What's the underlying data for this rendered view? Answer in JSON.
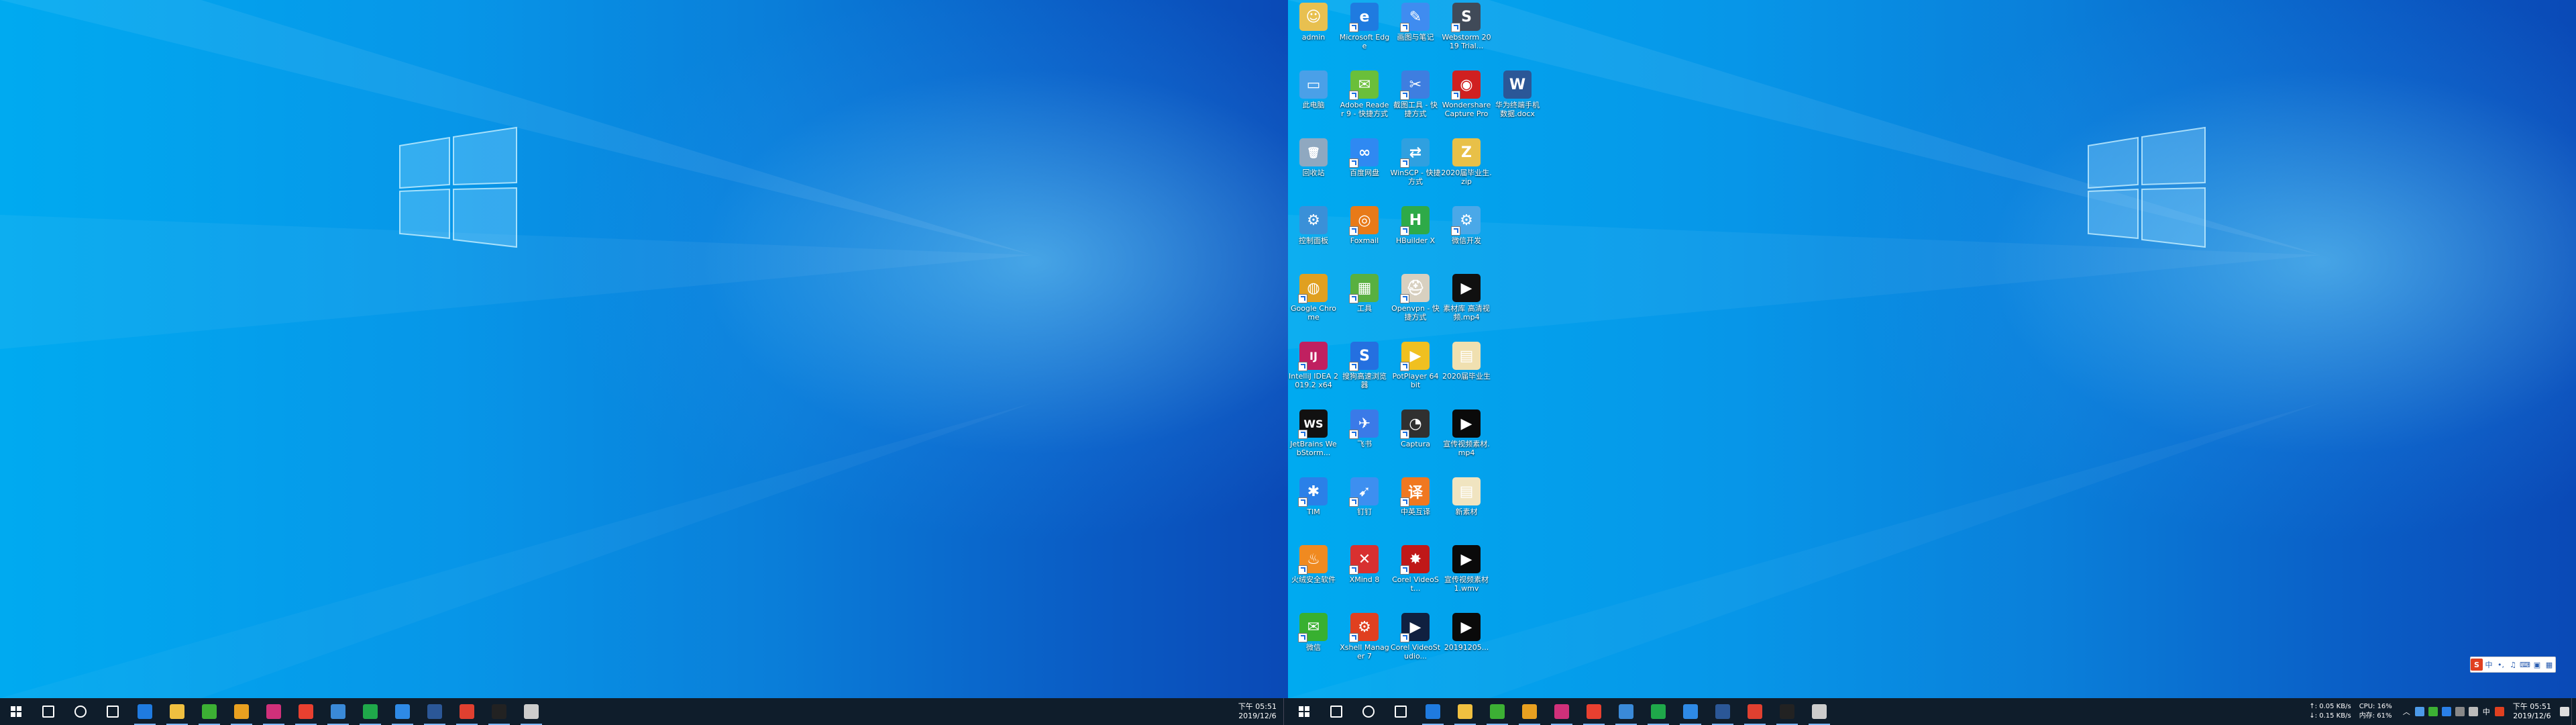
{
  "left_monitor": {
    "taskbar": {
      "apps": [
        {
          "name": "search-icon",
          "color": "#ffffff"
        },
        {
          "name": "cortana-icon",
          "color": "#ffffff"
        },
        {
          "name": "task-view-icon",
          "color": "#ffffff"
        },
        {
          "name": "edge-icon",
          "color": "#1f7be0"
        },
        {
          "name": "file-explorer-icon",
          "color": "#f0c040"
        },
        {
          "name": "wechat-icon",
          "color": "#3cb034"
        },
        {
          "name": "chrome-icon",
          "color": "#e8a020"
        },
        {
          "name": "idea-icon",
          "color": "#d0307a"
        },
        {
          "name": "maps-icon",
          "color": "#e84030"
        },
        {
          "name": "chart-app-icon",
          "color": "#3a8ad8"
        },
        {
          "name": "heidisql-icon",
          "color": "#1fa84a"
        },
        {
          "name": "notes-icon",
          "color": "#2e8ae6"
        },
        {
          "name": "word-icon",
          "color": "#2b5797"
        },
        {
          "name": "red-app-icon",
          "color": "#e04030"
        },
        {
          "name": "terminal-icon",
          "color": "#222222"
        },
        {
          "name": "typora-icon",
          "color": "#cccccc"
        }
      ],
      "clock": {
        "time": "下午 05:51",
        "date": "2019/12/6"
      }
    }
  },
  "right_monitor": {
    "desktop_icons": [
      {
        "label": "admin",
        "color": "#e8c050",
        "glyph": "☺",
        "col": 0,
        "row": 0,
        "shortcut": false
      },
      {
        "label": "Microsoft Edge",
        "color": "#1f7be0",
        "glyph": "e",
        "col": 1,
        "row": 0,
        "shortcut": true
      },
      {
        "label": "画图与笔记",
        "color": "#3f8cf0",
        "glyph": "✎",
        "col": 2,
        "row": 0,
        "shortcut": true
      },
      {
        "label": "Webstorm 2019 Trial...",
        "color": "#404a58",
        "glyph": "S",
        "col": 3,
        "row": 0,
        "shortcut": true
      },
      {
        "label": "此电脑",
        "color": "#4aa0e8",
        "glyph": "▭",
        "col": 0,
        "row": 1,
        "shortcut": false
      },
      {
        "label": "Adobe Reader 9 - 快捷方式",
        "color": "#6abf3a",
        "glyph": "✉",
        "col": 1,
        "row": 1,
        "shortcut": true
      },
      {
        "label": "截图工具 - 快捷方式",
        "color": "#3e7ee0",
        "glyph": "✂",
        "col": 2,
        "row": 1,
        "shortcut": true
      },
      {
        "label": "Wondershare Capture Pro",
        "color": "#d02020",
        "glyph": "◉",
        "col": 3,
        "row": 1,
        "shortcut": true
      },
      {
        "label": "华为终端手机数据.docx",
        "color": "#2b5797",
        "glyph": "W",
        "col": 4,
        "row": 1,
        "shortcut": false
      },
      {
        "label": "回收站",
        "color": "#8fa8c0",
        "glyph": "🗑",
        "col": 0,
        "row": 2,
        "shortcut": false
      },
      {
        "label": "百度网盘",
        "color": "#2f89f2",
        "glyph": "∞",
        "col": 1,
        "row": 2,
        "shortcut": true
      },
      {
        "label": "WinSCP - 快捷方式",
        "color": "#2fa0e0",
        "glyph": "⇄",
        "col": 2,
        "row": 2,
        "shortcut": true
      },
      {
        "label": "2020届毕业生.zip",
        "color": "#e8c048",
        "glyph": "Z",
        "col": 3,
        "row": 2,
        "shortcut": false
      },
      {
        "label": "控制面板",
        "color": "#3a90d8",
        "glyph": "⚙",
        "col": 0,
        "row": 3,
        "shortcut": false
      },
      {
        "label": "Foxmail",
        "color": "#e87a18",
        "glyph": "◎",
        "col": 1,
        "row": 3,
        "shortcut": true
      },
      {
        "label": "HBuilder X",
        "color": "#2eaa48",
        "glyph": "H",
        "col": 2,
        "row": 3,
        "shortcut": true
      },
      {
        "label": "微信开发",
        "color": "#4aa8e8",
        "glyph": "⚙",
        "col": 3,
        "row": 3,
        "shortcut": true
      },
      {
        "label": "Google Chrome",
        "color": "#e0a020",
        "glyph": "◍",
        "col": 0,
        "row": 4,
        "shortcut": true
      },
      {
        "label": "工具",
        "color": "#58b040",
        "glyph": "▦",
        "col": 1,
        "row": 4,
        "shortcut": true
      },
      {
        "label": "Openvpn - 快捷方式",
        "color": "#d8d0c0",
        "glyph": "⛑",
        "col": 2,
        "row": 4,
        "shortcut": true
      },
      {
        "label": "素材库 高清视频.mp4",
        "color": "#101010",
        "glyph": "▶",
        "col": 3,
        "row": 4,
        "shortcut": false
      },
      {
        "label": "IntelliJ IDEA 2019.2 x64",
        "color": "#c02060",
        "glyph": "IJ",
        "col": 0,
        "row": 5,
        "shortcut": true
      },
      {
        "label": "搜狗高速浏览器",
        "color": "#2470e0",
        "glyph": "S",
        "col": 1,
        "row": 5,
        "shortcut": true
      },
      {
        "label": "PotPlayer 64 bit",
        "color": "#f0c020",
        "glyph": "▶",
        "col": 2,
        "row": 5,
        "shortcut": true
      },
      {
        "label": "2020届毕业生",
        "color": "#f0e0b0",
        "glyph": "▤",
        "col": 3,
        "row": 5,
        "shortcut": false
      },
      {
        "label": "JetBrains WebStorm...",
        "color": "#111111",
        "glyph": "WS",
        "col": 0,
        "row": 6,
        "shortcut": true
      },
      {
        "label": "飞书",
        "color": "#3a7ae8",
        "glyph": "✈",
        "col": 1,
        "row": 6,
        "shortcut": true
      },
      {
        "label": "Captura",
        "color": "#303030",
        "glyph": "◔",
        "col": 2,
        "row": 6,
        "shortcut": true
      },
      {
        "label": "宣传视频素材.mp4",
        "color": "#0a0a0a",
        "glyph": "▶",
        "col": 3,
        "row": 6,
        "shortcut": false
      },
      {
        "label": "TIM",
        "color": "#2a80e8",
        "glyph": "✱",
        "col": 0,
        "row": 7,
        "shortcut": true
      },
      {
        "label": "钉钉",
        "color": "#3d8ff0",
        "glyph": "➹",
        "col": 1,
        "row": 7,
        "shortcut": true
      },
      {
        "label": "中英互译",
        "color": "#f07820",
        "glyph": "译",
        "col": 2,
        "row": 7,
        "shortcut": true
      },
      {
        "label": "新素材",
        "color": "#f0e4c0",
        "glyph": "▤",
        "col": 3,
        "row": 7,
        "shortcut": false
      },
      {
        "label": "火绒安全软件",
        "color": "#f08a20",
        "glyph": "♨",
        "col": 0,
        "row": 8,
        "shortcut": true
      },
      {
        "label": "XMind 8",
        "color": "#d83030",
        "glyph": "✕",
        "col": 1,
        "row": 8,
        "shortcut": true
      },
      {
        "label": "Corel VideoSt...",
        "color": "#c01818",
        "glyph": "✸",
        "col": 2,
        "row": 8,
        "shortcut": true
      },
      {
        "label": "宣传视频素材1.wmv",
        "color": "#0a0a0a",
        "glyph": "▶",
        "col": 3,
        "row": 8,
        "shortcut": false
      },
      {
        "label": "微信",
        "color": "#38b030",
        "glyph": "✉",
        "col": 0,
        "row": 9,
        "shortcut": true
      },
      {
        "label": "Xshell Manager 7",
        "color": "#e04020",
        "glyph": "⚙",
        "col": 1,
        "row": 9,
        "shortcut": true
      },
      {
        "label": "Corel VideoStudio...",
        "color": "#102040",
        "glyph": "▶",
        "col": 2,
        "row": 9,
        "shortcut": true
      },
      {
        "label": "20191205...",
        "color": "#0a0a0a",
        "glyph": "▶",
        "col": 3,
        "row": 9,
        "shortcut": false
      }
    ],
    "taskbar": {
      "apps": [
        {
          "name": "search-icon",
          "color": "#ffffff"
        },
        {
          "name": "cortana-icon",
          "color": "#ffffff"
        },
        {
          "name": "task-view-icon",
          "color": "#ffffff"
        },
        {
          "name": "edge-icon",
          "color": "#1f7be0"
        },
        {
          "name": "file-explorer-icon",
          "color": "#f0c040"
        },
        {
          "name": "wechat-icon",
          "color": "#3cb034"
        },
        {
          "name": "chrome-icon",
          "color": "#e8a020"
        },
        {
          "name": "idea-icon",
          "color": "#d0307a"
        },
        {
          "name": "maps-icon",
          "color": "#e84030"
        },
        {
          "name": "chart-app-icon",
          "color": "#3a8ad8"
        },
        {
          "name": "heidisql-icon",
          "color": "#1fa84a"
        },
        {
          "name": "notes-icon",
          "color": "#2e8ae6"
        },
        {
          "name": "word-icon",
          "color": "#2b5797"
        },
        {
          "name": "red-app-icon",
          "color": "#e04030"
        },
        {
          "name": "terminal-icon",
          "color": "#222222"
        },
        {
          "name": "typora-icon",
          "color": "#cccccc"
        }
      ],
      "net_up": "↑: 0.05 KB/s",
      "net_down": "↓: 0.15 KB/s",
      "cpu": "CPU: 16%",
      "mem": "内存: 61%",
      "ime_mode": "中",
      "clock": {
        "time": "下午 05:51",
        "date": "2019/12/6"
      }
    }
  }
}
